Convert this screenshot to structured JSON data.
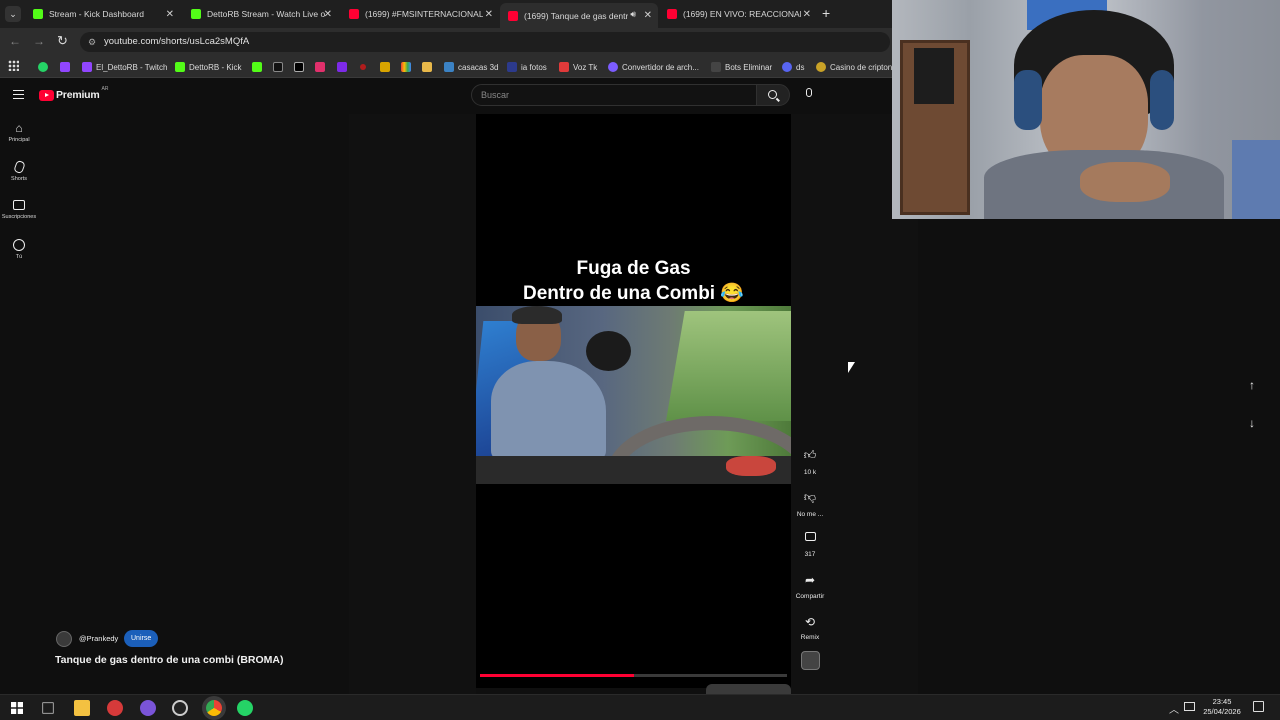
{
  "tabs": [
    {
      "label": "Stream - Kick Dashboard",
      "color": "#53fc18"
    },
    {
      "label": "DettoRB Stream - Watch Live o",
      "color": "#53fc18"
    },
    {
      "label": "(1699) #FMSINTERNACIONAL 2",
      "color": "#ff0033"
    },
    {
      "label": "(1699) Tanque de gas dentr",
      "color": "#ff0033"
    },
    {
      "label": "(1699) EN VIVO: REACCIONANE",
      "color": "#ff0033"
    }
  ],
  "url": "youtube.com/shorts/usLca2sMQfA",
  "bookmarks": [
    {
      "label": "El_DettoRB - Twitch"
    },
    {
      "label": "DettoRB - Kick"
    },
    {
      "label": "casacas 3d"
    },
    {
      "label": "ia fotos"
    },
    {
      "label": "Voz Tk"
    },
    {
      "label": "Convertidor de arch..."
    },
    {
      "label": "Bots Eliminar"
    },
    {
      "label": "ds"
    },
    {
      "label": "Casino de cripton"
    }
  ],
  "youtube": {
    "logo_text": "Premium",
    "region": "AR",
    "search_placeholder": "Buscar"
  },
  "sidenav": [
    {
      "label": "Principal",
      "icon": "home-icon"
    },
    {
      "label": "Shorts",
      "icon": "shorts-icon"
    },
    {
      "label": "Suscripciones",
      "icon": "subscriptions-icon"
    },
    {
      "label": "Tú",
      "icon": "you-icon"
    }
  ],
  "short": {
    "caption_line1": "Fuga de Gas",
    "caption_line2": "Dentro de una Combi 😂",
    "channel": "@Prankedy",
    "join_label": "Unirse",
    "title": "Tanque de gas dentro de una combi (BROMA)",
    "progress_percent": 50
  },
  "actions": {
    "likes": "10 k",
    "dislike": "No me ...",
    "comments": "317",
    "share": "Compartir",
    "remix": "Remix"
  },
  "taskbar": {
    "time": "23:45",
    "date": "25/04/2026"
  }
}
